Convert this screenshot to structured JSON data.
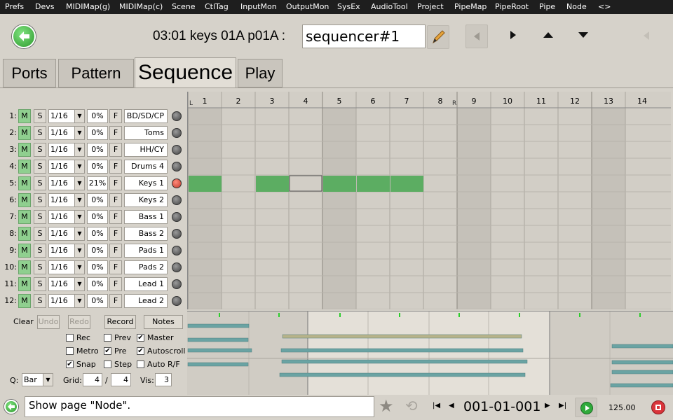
{
  "menu": [
    "Prefs",
    "Devs",
    "MIDIMap(g)",
    "MIDIMap(c)",
    "Scene",
    "CtlTag",
    "InputMon",
    "OutputMon",
    "SysEx",
    "AudioTool",
    "Project",
    "PipeMap",
    "PipeRoot",
    "Pipe",
    "Node",
    "<>"
  ],
  "header": {
    "status": "03:01 keys  01A  p01A :",
    "name_value": "sequencer#1"
  },
  "tabs": [
    "Ports",
    "Pattern",
    "Sequence",
    "Play"
  ],
  "tracks": [
    {
      "num": "1:",
      "m": "M",
      "s": "S",
      "len": "1/16",
      "pct": "0%",
      "f": "F",
      "name": "BD/SD/CP",
      "active": false
    },
    {
      "num": "2:",
      "m": "M",
      "s": "S",
      "len": "1/16",
      "pct": "0%",
      "f": "F",
      "name": "Toms",
      "active": false
    },
    {
      "num": "3:",
      "m": "M",
      "s": "S",
      "len": "1/16",
      "pct": "0%",
      "f": "F",
      "name": "HH/CY",
      "active": false
    },
    {
      "num": "4:",
      "m": "M",
      "s": "S",
      "len": "1/16",
      "pct": "0%",
      "f": "F",
      "name": "Drums 4",
      "active": false
    },
    {
      "num": "5:",
      "m": "M",
      "s": "S",
      "len": "1/16",
      "pct": "21%",
      "f": "F",
      "name": "Keys 1",
      "active": true
    },
    {
      "num": "6:",
      "m": "M",
      "s": "S",
      "len": "1/16",
      "pct": "0%",
      "f": "F",
      "name": "Keys 2",
      "active": false
    },
    {
      "num": "7:",
      "m": "M",
      "s": "S",
      "len": "1/16",
      "pct": "0%",
      "f": "F",
      "name": "Bass 1",
      "active": false
    },
    {
      "num": "8:",
      "m": "M",
      "s": "S",
      "len": "1/16",
      "pct": "0%",
      "f": "F",
      "name": "Bass 2",
      "active": false
    },
    {
      "num": "9:",
      "m": "M",
      "s": "S",
      "len": "1/16",
      "pct": "0%",
      "f": "F",
      "name": "Pads 1",
      "active": false
    },
    {
      "num": "10:",
      "m": "M",
      "s": "S",
      "len": "1/16",
      "pct": "0%",
      "f": "F",
      "name": "Pads 2",
      "active": false
    },
    {
      "num": "11:",
      "m": "M",
      "s": "S",
      "len": "1/16",
      "pct": "0%",
      "f": "F",
      "name": "Lead 1",
      "active": false
    },
    {
      "num": "12:",
      "m": "M",
      "s": "S",
      "len": "1/16",
      "pct": "0%",
      "f": "F",
      "name": "Lead 2",
      "active": false
    }
  ],
  "timeline": {
    "bars": [
      "1",
      "2",
      "3",
      "4",
      "5",
      "6",
      "7",
      "8",
      "9",
      "10",
      "11",
      "12",
      "13",
      "14"
    ],
    "loop_left": "L",
    "loop_right": "R",
    "clips_row5": [
      1,
      3,
      5,
      6,
      7
    ],
    "selected_bar": 4
  },
  "controls": {
    "clear": "Clear",
    "undo": "Undo",
    "redo": "Redo",
    "record": "Record",
    "notes": "Notes",
    "rec": "Rec",
    "prev": "Prev",
    "master": "Master",
    "metro": "Metro",
    "pre": "Pre",
    "autoscroll": "Autoscroll",
    "snap": "Snap",
    "step": "Step",
    "auto_rf": "Auto R/F",
    "q_label": "Q:",
    "q_value": "Bar",
    "grid_label": "Grid:",
    "grid_a": "4",
    "grid_sep": "/",
    "grid_b": "4",
    "vis_label": "Vis:",
    "vis_value": "3",
    "checks": {
      "rec": false,
      "prev": false,
      "master": true,
      "metro": false,
      "pre": true,
      "autoscroll": true,
      "snap": true,
      "step": false,
      "auto_rf": false
    }
  },
  "status_bar": {
    "message": "Show page \"Node\".",
    "position": "001-01-001",
    "tempo": "125.00"
  },
  "colors": {
    "clip": "#5cad62",
    "menubar": "#1e1e1e",
    "note_bar": "#6aa3a3"
  }
}
